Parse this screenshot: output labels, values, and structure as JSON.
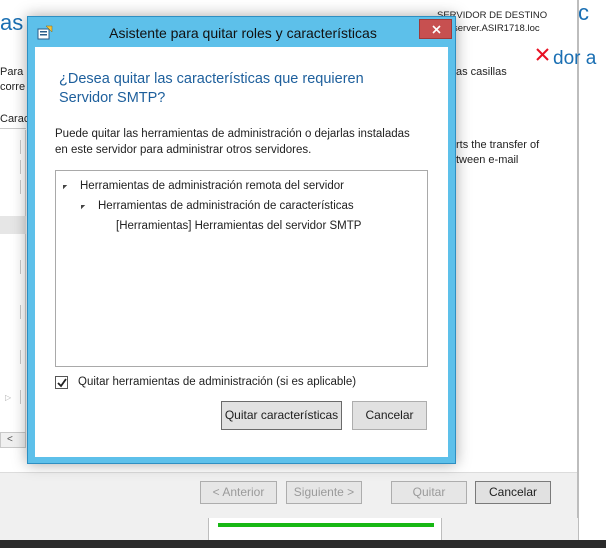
{
  "background_wizard": {
    "title_fragment": "as",
    "title_fragment_right": "dor a",
    "server_label": "SERVIDOR DE DESTINO",
    "server_name": "server.ASIR1718.loc",
    "text_left_1": "Para",
    "text_left_2": "corre",
    "text_left_3": "Carac",
    "text_right_1": "as casillas",
    "text_right_2": "rts the transfer of",
    "text_right_3": "tween e-mail",
    "buttons": {
      "previous": "< Anterior",
      "next": "Siguiente >",
      "remove": "Quitar",
      "cancel": "Cancelar"
    },
    "close_color": "#e81123"
  },
  "dialog": {
    "title": "Asistente para quitar roles y características",
    "question": "¿Desea quitar las características que requieren Servidor SMTP?",
    "description": "Puede quitar las herramientas de administración o dejarlas instaladas en este servidor para administrar otros servidores.",
    "tree": [
      {
        "label": "Herramientas de administración remota del servidor",
        "level": 0,
        "expanded": true
      },
      {
        "label": "Herramientas de administración de características",
        "level": 1,
        "expanded": true
      },
      {
        "label": "[Herramientas] Herramientas del servidor SMTP",
        "level": 2,
        "expanded": false
      }
    ],
    "checkbox": {
      "label": "Quitar herramientas de administración (si es aplicable)",
      "checked": true
    },
    "buttons": {
      "remove": "Quitar características",
      "cancel": "Cancelar"
    },
    "colors": {
      "frame": "#5dc0ea",
      "close_button": "#c75050",
      "question_text": "#1d5f9c"
    }
  }
}
